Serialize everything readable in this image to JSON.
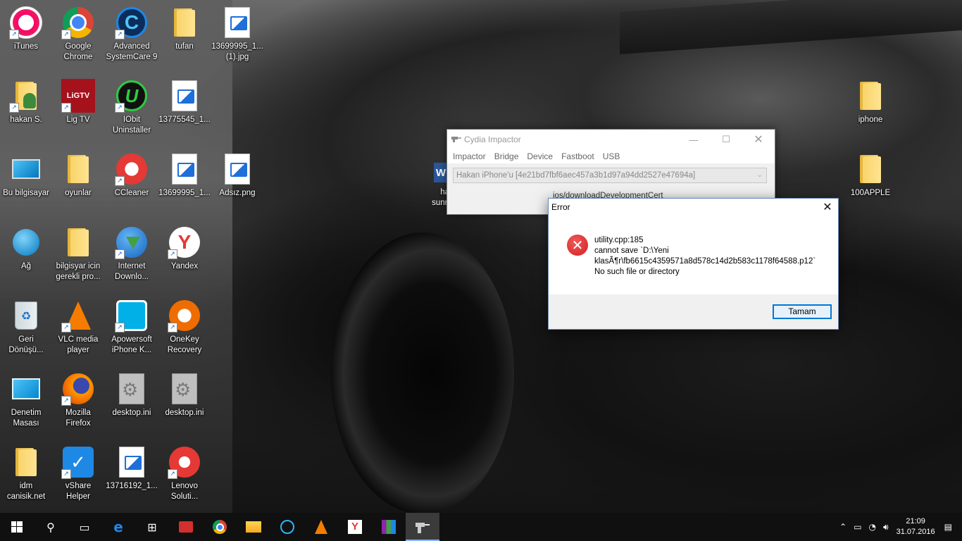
{
  "desktop": {
    "icons": [
      {
        "label": "iTunes",
        "icon": "itunes-icon"
      },
      {
        "label": "Google\nChrome",
        "icon": "chrome-icon"
      },
      {
        "label": "Advanced\nSystemCare 9",
        "icon": "advanced-systemcare-icon"
      },
      {
        "label": "tufan",
        "icon": "folder-icon"
      },
      {
        "label": "13699995_1...\n(1).jpg",
        "icon": "image-file-icon"
      },
      {
        "label": "hakan S.",
        "icon": "user-folder-icon"
      },
      {
        "label": "Lig TV",
        "icon": "ligtv-icon"
      },
      {
        "label": "IObit\nUninstaller",
        "icon": "iobit-uninstaller-icon"
      },
      {
        "label": "13775545_1...",
        "icon": "image-file-icon"
      },
      {
        "label": "Bu bilgisayar",
        "icon": "computer-icon"
      },
      {
        "label": "oyunlar",
        "icon": "folder-icon"
      },
      {
        "label": "CCleaner",
        "icon": "ccleaner-icon"
      },
      {
        "label": "13699995_1...",
        "icon": "image-file-icon"
      },
      {
        "label": "Adsız.png",
        "icon": "image-file-icon"
      },
      {
        "label": "Ağ",
        "icon": "network-icon"
      },
      {
        "label": "bilgisyar icin\ngerekli pro...",
        "icon": "folder-icon"
      },
      {
        "label": "Internet\nDownlo...",
        "icon": "internet-download-manager-icon"
      },
      {
        "label": "Yandex",
        "icon": "yandex-icon"
      },
      {
        "label": "Geri\nDönüşü...",
        "icon": "recycle-bin-icon"
      },
      {
        "label": "VLC media\nplayer",
        "icon": "vlc-icon"
      },
      {
        "label": "Apowersoft\niPhone K...",
        "icon": "apowersoft-icon"
      },
      {
        "label": "OneKey\nRecovery",
        "icon": "onekey-recovery-icon"
      },
      {
        "label": "Denetim\nMasası",
        "icon": "control-panel-icon"
      },
      {
        "label": "Mozilla\nFirefox",
        "icon": "firefox-icon"
      },
      {
        "label": "desktop.ini",
        "icon": "settings-file-icon"
      },
      {
        "label": "desktop.ini",
        "icon": "settings-file-icon"
      },
      {
        "label": "idm\ncanisik.net",
        "icon": "folder-icon"
      },
      {
        "label": "vShare\nHelper",
        "icon": "vshare-icon"
      },
      {
        "label": "13716192_1...",
        "icon": "image-file-icon"
      },
      {
        "label": "Lenovo\nSoluti...",
        "icon": "lenovo-solutions-icon"
      },
      {
        "label": "iphone",
        "icon": "folder-icon"
      },
      {
        "label": "100APPLE",
        "icon": "folder-icon"
      }
    ],
    "partial_word_label": "ha\nsunn"
  },
  "impactor": {
    "title": "Cydia Impactor",
    "menu": [
      "Impactor",
      "Bridge",
      "Device",
      "Fastboot",
      "USB"
    ],
    "device": "Hakan iPhone'u [4e21bd7fbf6aec457a3b1d97a94dd2527e47694a]",
    "status": "ios/downloadDevelopmentCert"
  },
  "error_dialog": {
    "title": "Error",
    "lines": [
      "utility.cpp:185",
      "cannot save `D:\\Yeni",
      "klasÃ¶r\\fb6615c4359571a8d578c14d2b583c1178f64588.p12`",
      "No such file or directory"
    ],
    "ok_label": "Tamam"
  },
  "taskbar": {
    "clock_time": "21:09",
    "clock_date": "31.07.2016"
  },
  "colors": {
    "accent": "#0078d7",
    "error_red": "#d21f1f",
    "taskbar_bg": "#101010"
  }
}
